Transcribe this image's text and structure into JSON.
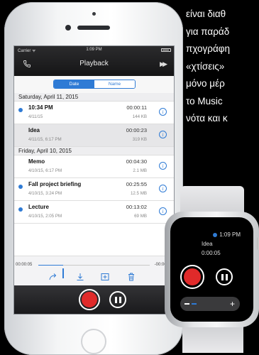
{
  "side_text": [
    "είναι διαθ",
    "για παράδ",
    "πχογράφη",
    "«χτίσεις»",
    "μόνο μέρ",
    "το Music",
    "νότα και κ"
  ],
  "status_bar": {
    "carrier": "Carrier ᯤ",
    "time": "1:09 PM"
  },
  "nav": {
    "title": "Playback"
  },
  "segments": [
    "Date",
    "Name"
  ],
  "sections": [
    {
      "header": "Saturday, April 11, 2015",
      "rows": [
        {
          "name": "10:34 PM",
          "date": "4/11/15",
          "duration": "00:00:11",
          "size": "144 KB",
          "dot": true,
          "selected": false
        },
        {
          "name": "Idea",
          "date": "4/11/15, 6:17 PM",
          "duration": "00:00:23",
          "size": "319 KB",
          "dot": false,
          "selected": true
        }
      ]
    },
    {
      "header": "Friday, April 10, 2015",
      "rows": [
        {
          "name": "Memo",
          "date": "4/10/15, 6:17 PM",
          "duration": "00:04:30",
          "size": "2.1 MB",
          "dot": false,
          "selected": false
        },
        {
          "name": "Fall project briefing",
          "date": "4/10/15, 3:24 PM",
          "duration": "00:25:55",
          "size": "12.5 MB",
          "dot": true,
          "selected": false
        },
        {
          "name": "Lecture",
          "date": "4/10/15, 2:05 PM",
          "duration": "00:13:02",
          "size": "69 MB",
          "dot": true,
          "selected": false
        }
      ]
    }
  ],
  "player": {
    "elapsed": "00:00:05",
    "remaining": "-00:00:18",
    "progress_fraction": 0.22
  },
  "colors": {
    "accent": "#2f7bd5",
    "record": "#e02a2a"
  },
  "watch": {
    "time": "1:09 PM",
    "name": "Idea",
    "duration": "0:00:05"
  }
}
